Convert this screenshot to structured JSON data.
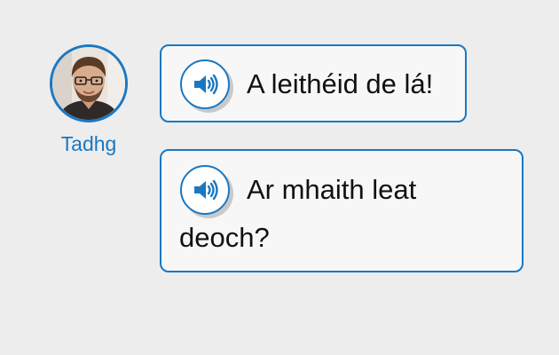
{
  "speaker": {
    "name": "Tadhg",
    "avatar_icon": "person-photo-avatar",
    "accent_color": "#1a78c2"
  },
  "messages": [
    {
      "text": "A leithéid de lá!",
      "icon": "speaker-audio-icon"
    },
    {
      "text_line1": "Ar mhaith leat",
      "text_line2": "deoch?",
      "icon": "speaker-audio-icon"
    }
  ]
}
